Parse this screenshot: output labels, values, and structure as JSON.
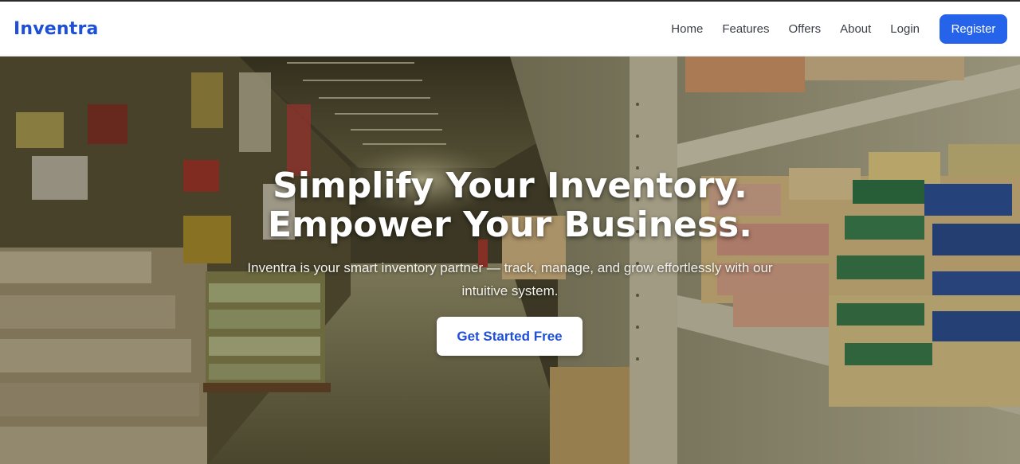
{
  "brand": {
    "name": "Inventra",
    "color": "#1d4fd8"
  },
  "nav": {
    "links": [
      "Home",
      "Features",
      "Offers",
      "About",
      "Login"
    ],
    "register_label": "Register"
  },
  "hero": {
    "title_line1": "Simplify Your Inventory.",
    "title_line2": "Empower Your Business.",
    "subtitle": "Inventra is your smart inventory partner — track, manage, and grow effortlessly with our intuitive system.",
    "cta_label": "Get Started Free",
    "background": "warehouse-aisle-photo"
  },
  "colors": {
    "accent": "#2563eb",
    "cta_text": "#1d4fd8"
  }
}
